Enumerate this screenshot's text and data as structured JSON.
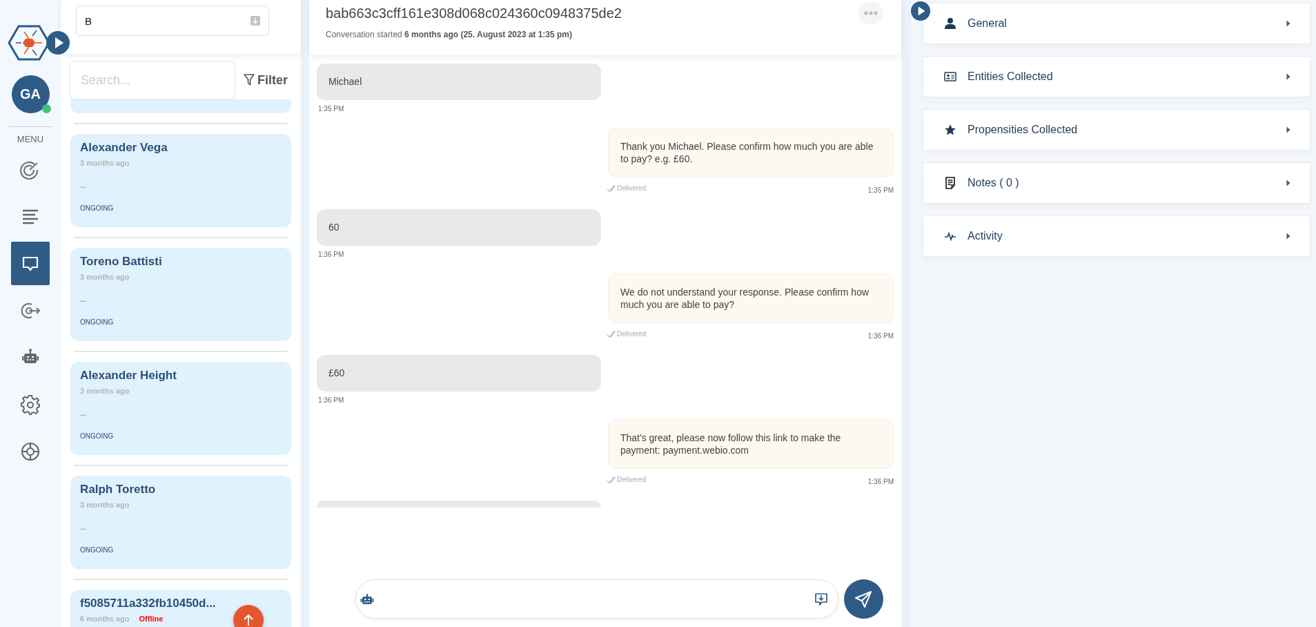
{
  "nav": {
    "avatar": {
      "initials": "GA",
      "online": true
    },
    "menu_label": "MENU",
    "items": [
      {
        "kind": "radar",
        "selected": false
      },
      {
        "kind": "lines",
        "selected": false
      },
      {
        "kind": "chat",
        "selected": true
      },
      {
        "kind": "target",
        "selected": false
      },
      {
        "kind": "robot",
        "selected": false
      },
      {
        "kind": "gear",
        "selected": false
      },
      {
        "kind": "lifebuoy",
        "selected": false
      }
    ]
  },
  "conversation_list": {
    "selector": {
      "value": "B"
    },
    "search": {
      "placeholder": "Search..."
    },
    "filter": "Filter",
    "conversations": [
      {
        "name": "Alexander Vega",
        "time": "3 months ago",
        "preview": "...",
        "status": "ONGOING",
        "kind": "ongoing"
      },
      {
        "name": "Toreno Battisti",
        "time": "3 months ago",
        "preview": "...",
        "status": "ONGOING",
        "kind": "ongoing"
      },
      {
        "name": "Alexander Height",
        "time": "3 months ago",
        "preview": "...",
        "status": "ONGOING",
        "kind": "ongoing"
      },
      {
        "name": "Ralph Toretto",
        "time": "3 months ago",
        "preview": "...",
        "status": "ONGOING",
        "kind": "ongoing"
      },
      {
        "name": "f5085711a332fb10450d...",
        "time": "6 months ago",
        "status": "Offline",
        "kind": "offline"
      }
    ]
  },
  "conversation": {
    "title": "bab663c3cff161e308d068c024360c0948375de2",
    "started": "Conversation started **6 months ago (25. August 2023 at 1:35 pm)**",
    "messages": [
      {
        "kind": "incoming",
        "text": "Michael",
        "time": "1:35 PM"
      },
      {
        "kind": "outgoing",
        "text": "Thank you Michael. Please confirm how much you are able to pay? e.g. £60.",
        "delivery": "Delivered",
        "time": "1:35 PM"
      },
      {
        "kind": "incoming",
        "text": "60",
        "time": "1:36 PM"
      },
      {
        "kind": "outgoing",
        "text": "We do not understand your response. Please confirm how much you are able to pay?",
        "delivery": "Delivered",
        "time": "1:36 PM"
      },
      {
        "kind": "incoming",
        "text": "£60",
        "time": "1:36 PM"
      },
      {
        "kind": "outgoing",
        "text": "That's great, please now follow this link to make the payment: payment.webio.com",
        "delivery": "Delivered",
        "time": "1:36 PM"
      }
    ]
  },
  "details": {
    "sections": [
      {
        "kind": "person",
        "label": "General",
        "expanded": false
      },
      {
        "kind": "id-card",
        "label": "Entities Collected",
        "expanded": false
      },
      {
        "kind": "star",
        "label": "Propensities Collected",
        "expanded": false
      },
      {
        "kind": "notes",
        "label": "Notes ( 0 )",
        "expanded": false
      },
      {
        "kind": "pulse",
        "label": "Activity",
        "expanded": false
      }
    ]
  }
}
